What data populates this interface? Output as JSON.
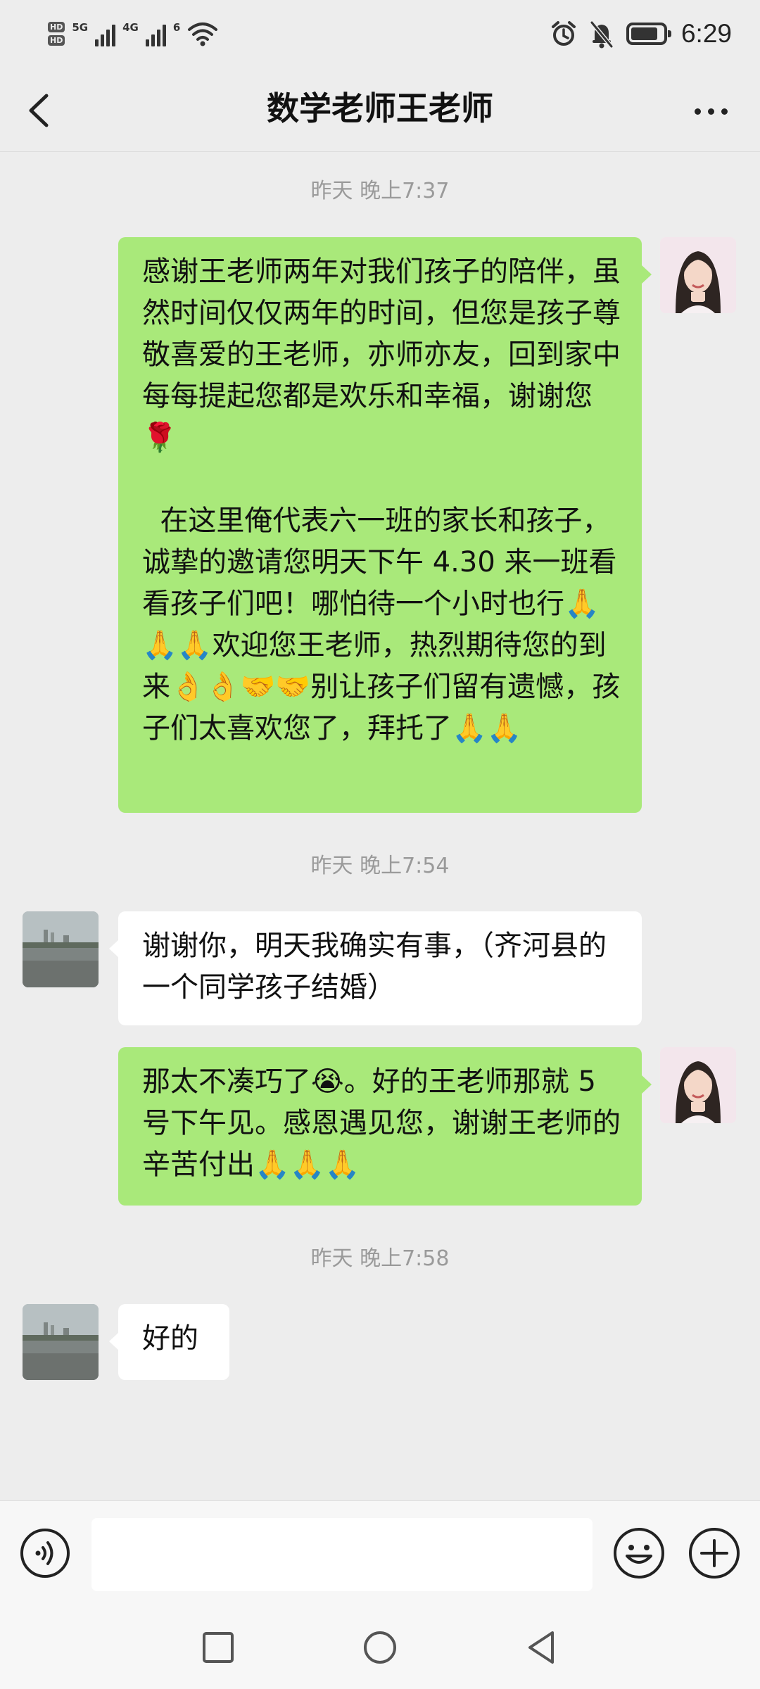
{
  "status_bar": {
    "hd_badges": [
      "HD",
      "HD"
    ],
    "network_labels": [
      "5G",
      "4G",
      "6"
    ],
    "time": "6:29",
    "battery_level": 0.85,
    "icons": [
      "alarm-icon",
      "bell-off-icon",
      "battery-icon",
      "wifi-icon"
    ]
  },
  "header": {
    "title": "数学老师王老师",
    "back_icon": "chevron-left-icon",
    "more_icon": "more-dots-icon"
  },
  "messages": [
    {
      "type": "timestamp",
      "text": "昨天 晚上7:37"
    },
    {
      "type": "message",
      "sender": "self",
      "text": "感谢王老师两年对我们孩子的陪伴，虽然时间仅仅两年的时间，但您是孩子尊敬喜爱的王老师，亦师亦友，回到家中每每提起您都是欢乐和幸福，谢谢您🌹\n\n  在这里俺代表六一班的家长和孩子，诚挚的邀请您明天下午 4.30 来一班看看孩子们吧！哪怕待一个小时也行🙏🙏🙏欢迎您王老师，热烈期待您的到来👌👌🤝🤝别让孩子们留有遗憾，孩子们太喜欢您了，拜托了🙏🙏"
    },
    {
      "type": "timestamp",
      "text": "昨天 晚上7:54"
    },
    {
      "type": "message",
      "sender": "other",
      "text": "谢谢你，明天我确实有事，（齐河县的一个同学孩子结婚）"
    },
    {
      "type": "message",
      "sender": "self",
      "text": "那太不凑巧了😭。好的王老师那就 5 号下午见。感恩遇见您，谢谢王老师的辛苦付出🙏🙏🙏"
    },
    {
      "type": "timestamp",
      "text": "昨天 晚上7:58"
    },
    {
      "type": "message",
      "sender": "other",
      "text": "好的"
    }
  ],
  "input_bar": {
    "placeholder": "",
    "icons": [
      "voice-icon",
      "emoji-icon",
      "plus-icon"
    ]
  },
  "nav_bar": {
    "icons": [
      "recent-apps-icon",
      "home-icon",
      "back-triangle-icon"
    ]
  },
  "colors": {
    "background": "#ededed",
    "self_bubble": "#a9e97a",
    "other_bubble": "#ffffff",
    "timestamp": "#9a9a9a"
  }
}
